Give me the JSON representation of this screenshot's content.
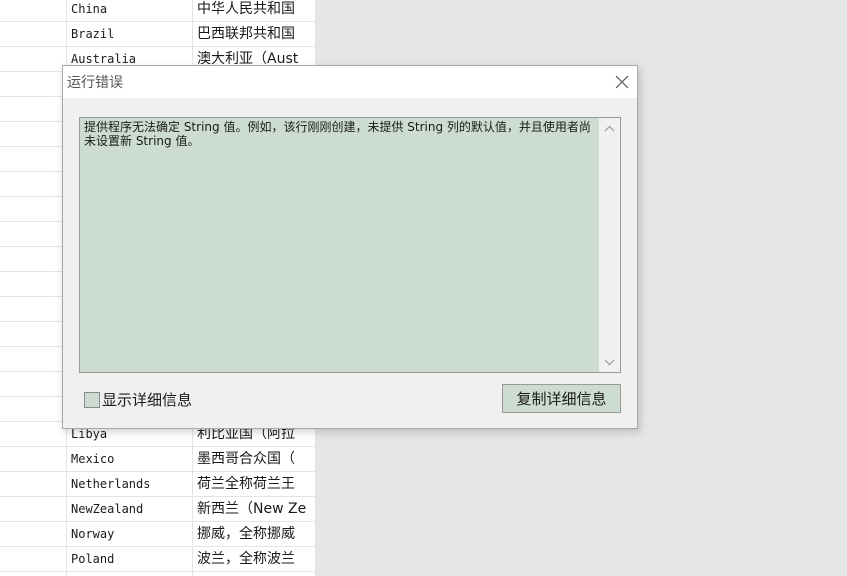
{
  "grid": {
    "rows": [
      {
        "en": "China",
        "zh": "中华人民共和国"
      },
      {
        "en": "Brazil",
        "zh": "巴西联邦共和国"
      },
      {
        "en": "Australia",
        "zh": "澳大利亚（Aust"
      },
      {
        "en": "",
        "zh": ""
      },
      {
        "en": "",
        "zh": ""
      },
      {
        "en": "",
        "zh": ""
      },
      {
        "en": "",
        "zh": ""
      },
      {
        "en": "",
        "zh": ""
      },
      {
        "en": "",
        "zh": ""
      },
      {
        "en": "",
        "zh": ""
      },
      {
        "en": "",
        "zh": ""
      },
      {
        "en": "",
        "zh": ""
      },
      {
        "en": "",
        "zh": ""
      },
      {
        "en": "",
        "zh": ""
      },
      {
        "en": "",
        "zh": ""
      },
      {
        "en": "",
        "zh": ""
      },
      {
        "en": "",
        "zh": ""
      },
      {
        "en": "Libya",
        "zh": "利比亚国（阿拉"
      },
      {
        "en": "Mexico",
        "zh": "墨西哥合众国（"
      },
      {
        "en": "Netherlands",
        "zh": "荷兰全称荷兰王"
      },
      {
        "en": "NewZealand",
        "zh": "新西兰（New Ze"
      },
      {
        "en": "Norway",
        "zh": "挪威，全称挪威"
      },
      {
        "en": "Poland",
        "zh": "波兰，全称波兰"
      },
      {
        "en": "",
        "zh": ""
      }
    ]
  },
  "dialog": {
    "title": "运行错误",
    "message": "提供程序无法确定 String 值。例如，该行刚刚创建，未提供 String 列的默认值，并且使用者尚未设置新 String 值。",
    "show_details_label": "显示详细信息",
    "copy_button_label": "复制详细信息"
  },
  "colors": {
    "panel_accent": "#ccdcd0"
  }
}
